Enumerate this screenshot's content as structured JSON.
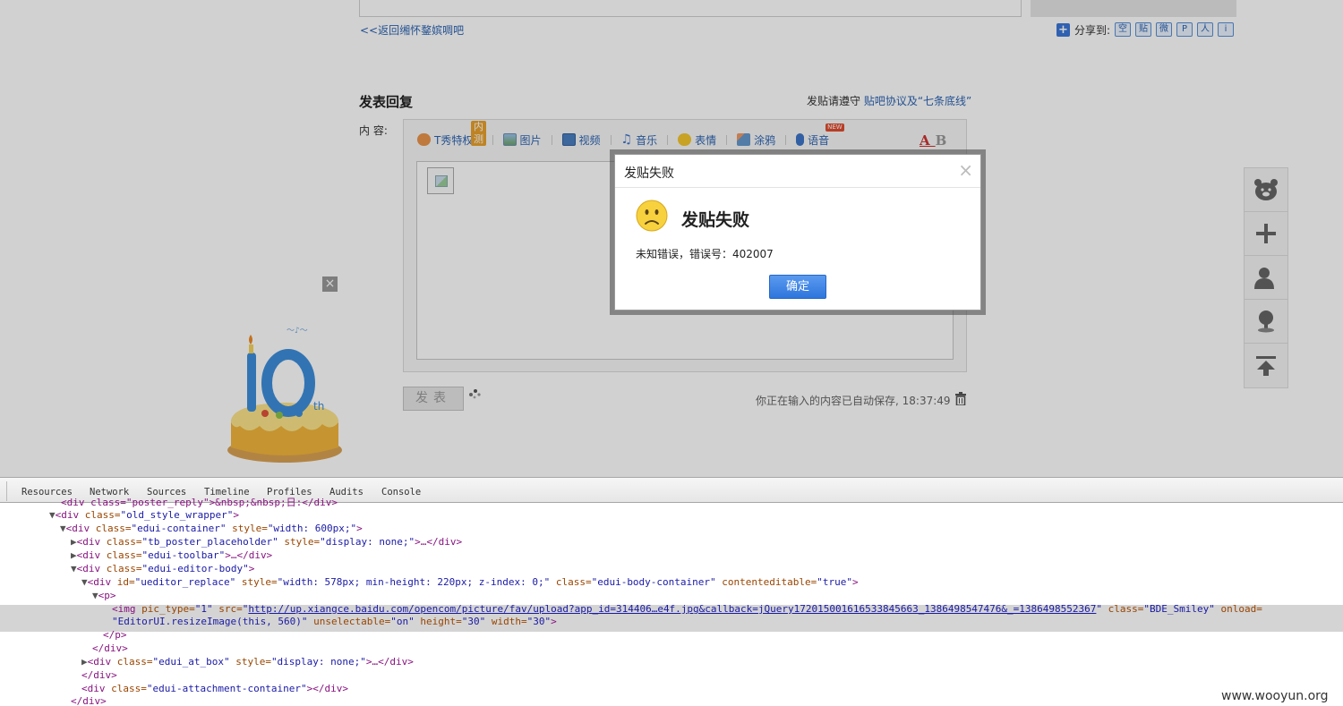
{
  "page": {
    "back_link": "<<返回缃怀鍪嫔啁吧",
    "share_label": "分享到:",
    "share_sites": [
      "空",
      "贴",
      "微",
      "P",
      "人",
      "i"
    ],
    "reply_title": "发表回复",
    "rules_prefix": "发贴请遵守 ",
    "rules_link": "贴吧协议及“七条底线”",
    "content_label": "内 容:",
    "toolbar": {
      "tshow": "T秀特权",
      "tshow_badge": "内测",
      "image": "图片",
      "video": "视频",
      "music": "音乐",
      "emoji": "表情",
      "doodle": "涂鸦",
      "voice": "语音",
      "voice_badge": "NEW",
      "font_a": "A",
      "font_b": "B"
    },
    "post_button": "发表",
    "autosave": "你正在输入的内容已自动保存, 18:37:49",
    "cake_close": "×"
  },
  "dialog": {
    "title": "发贴失败",
    "close": "×",
    "heading": "发贴失败",
    "message": "未知错误，错误号：402007",
    "ok": "确定"
  },
  "devtools": {
    "tabs": [
      "Resources",
      "Network",
      "Sources",
      "Timeline",
      "Profiles",
      "Audits",
      "Console"
    ],
    "lines": {
      "l0": "<div class=\"poster_reply\">&nbsp;&nbsp;日:</div>",
      "l1_tag": "<div",
      "l1_attr": " class=",
      "l1_val": "\"old_style_wrapper\"",
      "l2_tag": "<div",
      "l2_attr1": " class=",
      "l2_val1": "\"edui-container\"",
      "l2_attr2": " style=",
      "l2_val2": "\"width: 600px;\"",
      "l3_tag": "<div",
      "l3_attr1": " class=",
      "l3_val1": "\"tb_poster_placeholder\"",
      "l3_attr2": " style=",
      "l3_val2": "\"display: none;\"",
      "l3_end": ">…</div>",
      "l4_tag": "<div",
      "l4_attr": " class=",
      "l4_val": "\"edui-toolbar\"",
      "l4_end": ">…</div>",
      "l5_tag": "<div",
      "l5_attr": " class=",
      "l5_val": "\"edui-editor-body\"",
      "l6_tag": "<div",
      "l6_attr1": " id=",
      "l6_val1": "\"ueditor_replace\"",
      "l6_attr2": " style=",
      "l6_val2": "\"width: 578px; min-height: 220px; z-index: 0;\"",
      "l6_attr3": " class=",
      "l6_val3": "\"edui-body-container\"",
      "l6_attr4": " contenteditable=",
      "l6_val4": "\"true\"",
      "l7": "<p>",
      "l8_tag": "<img",
      "l8_attr1": " pic_type=",
      "l8_val1": "\"1\"",
      "l8_attr2": " src=",
      "l8_url": "http://up.xiangce.baidu.com/opencom/picture/fav/upload?app_id=314406…e4f.jpg&callback=jQuery172015001616533845663_1386498547476&_=1386498552367",
      "l8_attr3": " class=",
      "l8_val3": "\"BDE_Smiley\"",
      "l8_attr4": " onload=",
      "l9_val": "\"EditorUI.resizeImage(this, 560)\"",
      "l9_attr1": " unselectable=",
      "l9_val1": "\"on\"",
      "l9_attr2": " height=",
      "l9_val2": "\"30\"",
      "l9_attr3": " width=",
      "l9_val3": "\"30\"",
      "l10": "</p>",
      "l11": "</div>",
      "l12_tag": "<div",
      "l12_attr1": " class=",
      "l12_val1": "\"edui_at_box\"",
      "l12_attr2": " style=",
      "l12_val2": "\"display: none;\"",
      "l12_end": ">…</div>",
      "l13": "</div>",
      "l14_tag": "<div",
      "l14_attr": " class=",
      "l14_val": "\"edui-attachment-container\"",
      "l14_end": "></div>",
      "l15": "</div>"
    }
  },
  "watermark": "www.wooyun.org"
}
